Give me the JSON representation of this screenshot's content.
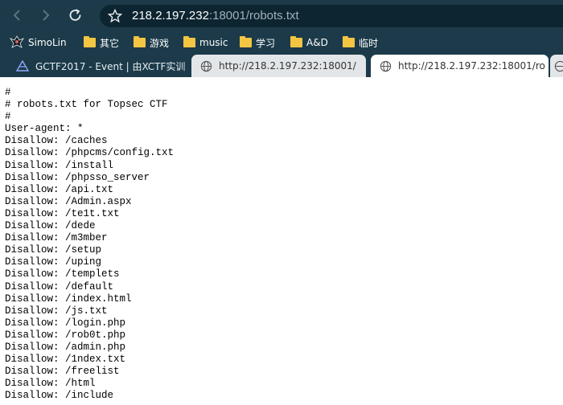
{
  "toolbar": {
    "url_host": "218.2.197.232",
    "url_rest": ":18001/robots.txt"
  },
  "bookmarks": [
    {
      "label": "SimoLin",
      "icon": "simolin-avatar-icon"
    },
    {
      "label": "其它",
      "icon": "folder-icon"
    },
    {
      "label": "游戏",
      "icon": "folder-icon"
    },
    {
      "label": "music",
      "icon": "folder-icon"
    },
    {
      "label": "学习",
      "icon": "folder-icon"
    },
    {
      "label": "A&D",
      "icon": "folder-icon"
    },
    {
      "label": "临时",
      "icon": "folder-icon"
    }
  ],
  "tabs": [
    {
      "title": "GCTF2017 - Event | 由XCTF实训",
      "icon": "xctf-logo-icon"
    },
    {
      "title": "http://218.2.197.232:18001/",
      "icon": "globe-icon"
    },
    {
      "title": "http://218.2.197.232:18001/ro",
      "icon": "globe-icon",
      "active": true
    },
    {
      "title": "",
      "icon": "globe-icon"
    }
  ],
  "content": {
    "lines": [
      "#",
      "# robots.txt for Topsec CTF",
      "#",
      "User-agent: *",
      "Disallow: /caches",
      "Disallow: /phpcms/config.txt",
      "Disallow: /install",
      "Disallow: /phpsso_server",
      "Disallow: /api.txt",
      "Disallow: /Admin.aspx",
      "Disallow: /te1t.txt",
      "Disallow: /dede",
      "Disallow: /m3mber",
      "Disallow: /setup",
      "Disallow: /uping",
      "Disallow: /templets",
      "Disallow: /default",
      "Disallow: /index.html",
      "Disallow: /js.txt",
      "Disallow: /login.php",
      "Disallow: /rob0t.php",
      "Disallow: /admin.php",
      "Disallow: /1ndex.txt",
      "Disallow: /freelist",
      "Disallow: /html",
      "Disallow: /include"
    ]
  }
}
